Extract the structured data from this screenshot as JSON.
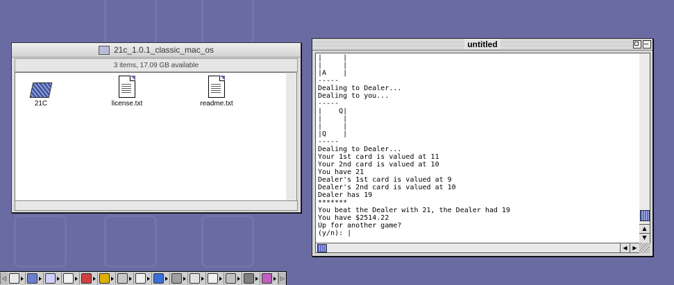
{
  "desktop": {
    "background": "#6b6ba3"
  },
  "finder": {
    "title": "21c_1.0.1_classic_mac_os",
    "info": "3 items, 17.09 GB available",
    "items": [
      {
        "name": "21C",
        "icon": "application-icon"
      },
      {
        "name": "license.txt",
        "icon": "text-document-icon"
      },
      {
        "name": "readme.txt",
        "icon": "text-document-icon"
      }
    ]
  },
  "terminal": {
    "title": "untitled",
    "lines": [
      "|     |",
      "|     |",
      "|A    |",
      "-----",
      "Dealing to Dealer...",
      "Dealing to you...",
      "-----",
      "|    Q|",
      "|     |",
      "|     |",
      "|Q    |",
      "-----",
      "Dealing to Dealer...",
      "Your 1st card is valued at 11",
      "Your 2nd card is valued at 10",
      "You have 21",
      "Dealer's 1st card is valued at 9",
      "Dealer's 2nd card is valued at 10",
      "Dealer has 19",
      "*******",
      "You beat the Dealer with 21, the Dealer had 19",
      "You have $2514.22",
      "Up for another game?",
      "(y/n): |"
    ]
  },
  "control_strip": {
    "modules": [
      "monitor-icon",
      "file-sharing-icon",
      "music-cd-icon",
      "lock-icon",
      "apple-talk-icon",
      "color-depth-icon",
      "resolution-icon",
      "printer-icon",
      "quicktime-icon",
      "remote-access-icon",
      "monitors-icon",
      "sound-volume-icon",
      "speech-icon",
      "help-icon",
      "web-sharing-icon"
    ]
  }
}
